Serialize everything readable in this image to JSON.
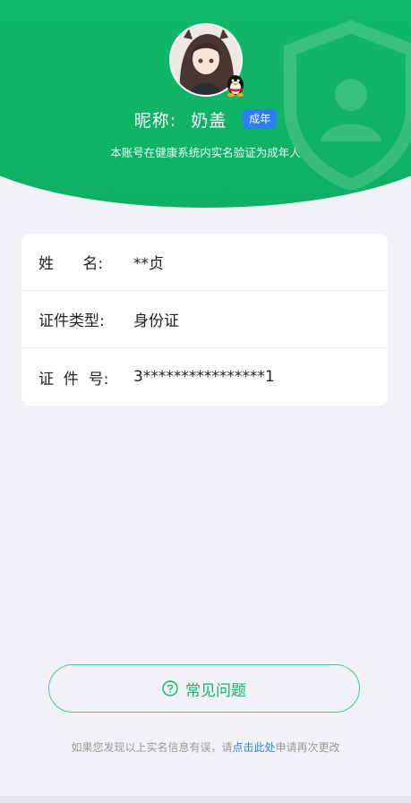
{
  "profile": {
    "nickname_label": "昵称:",
    "nickname": "奶盖",
    "age_badge": "成年",
    "verify_note": "本账号在健康系统内实名验证为成年人"
  },
  "info": {
    "rows": [
      {
        "label": "姓      名:",
        "value": "**贞"
      },
      {
        "label": "证件类型:",
        "value": "身份证"
      },
      {
        "label": "证  件  号:",
        "value": "3****************1"
      }
    ]
  },
  "faq": {
    "label": "常见问题",
    "icon": "question-circle-icon"
  },
  "footer": {
    "prefix": "如果您发现以上实名信息有误，请",
    "link": "点击此处",
    "suffix": "申请再次更改"
  },
  "colors": {
    "brand_green": "#12b96a",
    "badge_blue": "#2f7df5",
    "link_blue": "#2f7df5",
    "page_bg": "#f0f2f5"
  }
}
